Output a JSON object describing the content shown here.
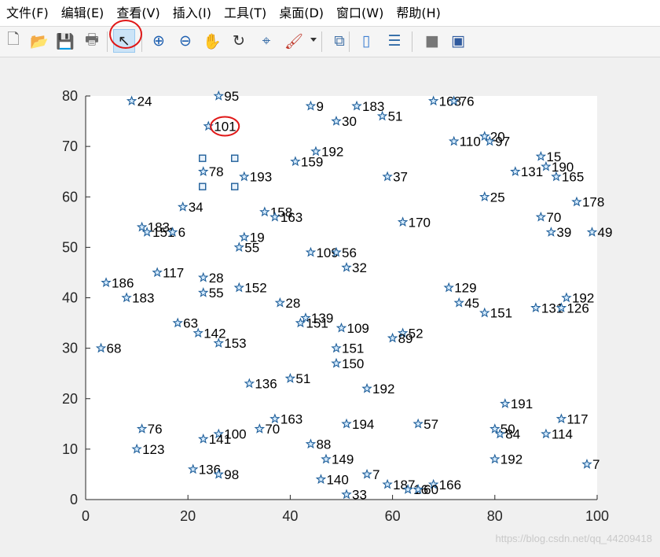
{
  "menu": [
    "文件(F)",
    "编辑(E)",
    "查看(V)",
    "插入(I)",
    "工具(T)",
    "桌面(D)",
    "窗口(W)",
    "帮助(H)"
  ],
  "toolbar": {
    "buttons": [
      {
        "name": "new-figure-icon",
        "glyph": "🗋"
      },
      {
        "name": "open-file-icon",
        "glyph": "📂"
      },
      {
        "name": "save-figure-icon",
        "glyph": "💾"
      },
      {
        "name": "print-figure-icon",
        "glyph": "🖶"
      },
      {
        "name": "edit-plot-pointer-icon",
        "glyph": "↖",
        "active": true
      },
      {
        "name": "zoom-in-icon",
        "glyph": "⊕"
      },
      {
        "name": "zoom-out-icon",
        "glyph": "⊖"
      },
      {
        "name": "pan-hand-icon",
        "glyph": "✋"
      },
      {
        "name": "rotate-3d-icon",
        "glyph": "↻"
      },
      {
        "name": "data-cursor-icon",
        "glyph": "⌖"
      },
      {
        "name": "brush-icon",
        "glyph": "🖌"
      },
      {
        "name": "link-plot-icon",
        "glyph": "⧉"
      },
      {
        "name": "insert-colorbar-icon",
        "glyph": "▯"
      },
      {
        "name": "insert-legend-icon",
        "glyph": "☰"
      },
      {
        "name": "hide-plot-tools-icon",
        "glyph": "■"
      },
      {
        "name": "show-plot-tools-icon",
        "glyph": "▣"
      }
    ]
  },
  "colors": {
    "marker": "#1f5f9a",
    "marker_fill": "#d6ecff",
    "annotation": "#e01818",
    "selection": "#1f5f9a"
  },
  "watermark": "https://blog.csdn.net/qq_44209418",
  "selected_point": "78",
  "chart_data": {
    "type": "scatter",
    "marker": "pentagram",
    "xlim": [
      0,
      100
    ],
    "ylim": [
      0,
      80
    ],
    "xticks": [
      0,
      20,
      40,
      60,
      80,
      100
    ],
    "yticks": [
      0,
      10,
      20,
      30,
      40,
      50,
      60,
      70,
      80
    ],
    "xlabel": "",
    "ylabel": "",
    "title": "",
    "points": [
      {
        "x": 9,
        "y": 79,
        "label": "24"
      },
      {
        "x": 26,
        "y": 80,
        "label": "95"
      },
      {
        "x": 44,
        "y": 78,
        "label": "9"
      },
      {
        "x": 53,
        "y": 78,
        "label": "183"
      },
      {
        "x": 49,
        "y": 75,
        "label": "30"
      },
      {
        "x": 58,
        "y": 76,
        "label": "51"
      },
      {
        "x": 68,
        "y": 79,
        "label": "168"
      },
      {
        "x": 72,
        "y": 79,
        "label": "76"
      },
      {
        "x": 24,
        "y": 74,
        "label": "101"
      },
      {
        "x": 72,
        "y": 71,
        "label": "110"
      },
      {
        "x": 78,
        "y": 72,
        "label": "20"
      },
      {
        "x": 79,
        "y": 71,
        "label": "97"
      },
      {
        "x": 45,
        "y": 69,
        "label": "192"
      },
      {
        "x": 41,
        "y": 67,
        "label": "159"
      },
      {
        "x": 89,
        "y": 68,
        "label": "15"
      },
      {
        "x": 90,
        "y": 66,
        "label": "190"
      },
      {
        "x": 84,
        "y": 65,
        "label": "131"
      },
      {
        "x": 92,
        "y": 64,
        "label": "165"
      },
      {
        "x": 23,
        "y": 65,
        "label": "78"
      },
      {
        "x": 31,
        "y": 64,
        "label": "193"
      },
      {
        "x": 59,
        "y": 64,
        "label": "37"
      },
      {
        "x": 78,
        "y": 60,
        "label": "25"
      },
      {
        "x": 19,
        "y": 58,
        "label": "34"
      },
      {
        "x": 96,
        "y": 59,
        "label": "178"
      },
      {
        "x": 35,
        "y": 57,
        "label": "158"
      },
      {
        "x": 37,
        "y": 56,
        "label": "163"
      },
      {
        "x": 89,
        "y": 56,
        "label": "70"
      },
      {
        "x": 62,
        "y": 55,
        "label": "170"
      },
      {
        "x": 11,
        "y": 54,
        "label": "183"
      },
      {
        "x": 12,
        "y": 53,
        "label": "151"
      },
      {
        "x": 17,
        "y": 53,
        "label": "6"
      },
      {
        "x": 91,
        "y": 53,
        "label": "39"
      },
      {
        "x": 99,
        "y": 53,
        "label": "49"
      },
      {
        "x": 31,
        "y": 52,
        "label": "19"
      },
      {
        "x": 30,
        "y": 50,
        "label": "55"
      },
      {
        "x": 44,
        "y": 49,
        "label": "109"
      },
      {
        "x": 49,
        "y": 49,
        "label": "56"
      },
      {
        "x": 51,
        "y": 46,
        "label": "32"
      },
      {
        "x": 14,
        "y": 45,
        "label": "117"
      },
      {
        "x": 23,
        "y": 44,
        "label": "28"
      },
      {
        "x": 4,
        "y": 43,
        "label": "186"
      },
      {
        "x": 30,
        "y": 42,
        "label": "152"
      },
      {
        "x": 23,
        "y": 41,
        "label": "55"
      },
      {
        "x": 71,
        "y": 42,
        "label": "129"
      },
      {
        "x": 8,
        "y": 40,
        "label": "183"
      },
      {
        "x": 94,
        "y": 40,
        "label": "192"
      },
      {
        "x": 38,
        "y": 39,
        "label": "28"
      },
      {
        "x": 73,
        "y": 39,
        "label": "45"
      },
      {
        "x": 88,
        "y": 38,
        "label": "131"
      },
      {
        "x": 93,
        "y": 38,
        "label": "126"
      },
      {
        "x": 78,
        "y": 37,
        "label": "151"
      },
      {
        "x": 43,
        "y": 36,
        "label": "139"
      },
      {
        "x": 42,
        "y": 35,
        "label": "151"
      },
      {
        "x": 18,
        "y": 35,
        "label": "63"
      },
      {
        "x": 50,
        "y": 34,
        "label": "109"
      },
      {
        "x": 22,
        "y": 33,
        "label": "142"
      },
      {
        "x": 62,
        "y": 33,
        "label": "52"
      },
      {
        "x": 60,
        "y": 32,
        "label": "89"
      },
      {
        "x": 26,
        "y": 31,
        "label": "153"
      },
      {
        "x": 3,
        "y": 30,
        "label": "68"
      },
      {
        "x": 49,
        "y": 30,
        "label": "151"
      },
      {
        "x": 49,
        "y": 27,
        "label": "150"
      },
      {
        "x": 40,
        "y": 24,
        "label": "51"
      },
      {
        "x": 32,
        "y": 23,
        "label": "136"
      },
      {
        "x": 55,
        "y": 22,
        "label": "192"
      },
      {
        "x": 82,
        "y": 19,
        "label": "191"
      },
      {
        "x": 93,
        "y": 16,
        "label": "117"
      },
      {
        "x": 37,
        "y": 16,
        "label": "163"
      },
      {
        "x": 51,
        "y": 15,
        "label": "194"
      },
      {
        "x": 65,
        "y": 15,
        "label": "57"
      },
      {
        "x": 11,
        "y": 14,
        "label": "76"
      },
      {
        "x": 34,
        "y": 14,
        "label": "70"
      },
      {
        "x": 80,
        "y": 14,
        "label": "50"
      },
      {
        "x": 26,
        "y": 13,
        "label": "100"
      },
      {
        "x": 81,
        "y": 13,
        "label": "84"
      },
      {
        "x": 90,
        "y": 13,
        "label": "114"
      },
      {
        "x": 23,
        "y": 12,
        "label": "141"
      },
      {
        "x": 44,
        "y": 11,
        "label": "88"
      },
      {
        "x": 10,
        "y": 10,
        "label": "123"
      },
      {
        "x": 47,
        "y": 8,
        "label": "149"
      },
      {
        "x": 80,
        "y": 8,
        "label": "192"
      },
      {
        "x": 98,
        "y": 7,
        "label": "7"
      },
      {
        "x": 21,
        "y": 6,
        "label": "136"
      },
      {
        "x": 26,
        "y": 5,
        "label": "98"
      },
      {
        "x": 55,
        "y": 5,
        "label": "7"
      },
      {
        "x": 46,
        "y": 4,
        "label": "140"
      },
      {
        "x": 59,
        "y": 3,
        "label": "187"
      },
      {
        "x": 68,
        "y": 3,
        "label": "166"
      },
      {
        "x": 63,
        "y": 2,
        "label": "16"
      },
      {
        "x": 65,
        "y": 2,
        "label": "60"
      },
      {
        "x": 51,
        "y": 1,
        "label": "33"
      }
    ]
  }
}
